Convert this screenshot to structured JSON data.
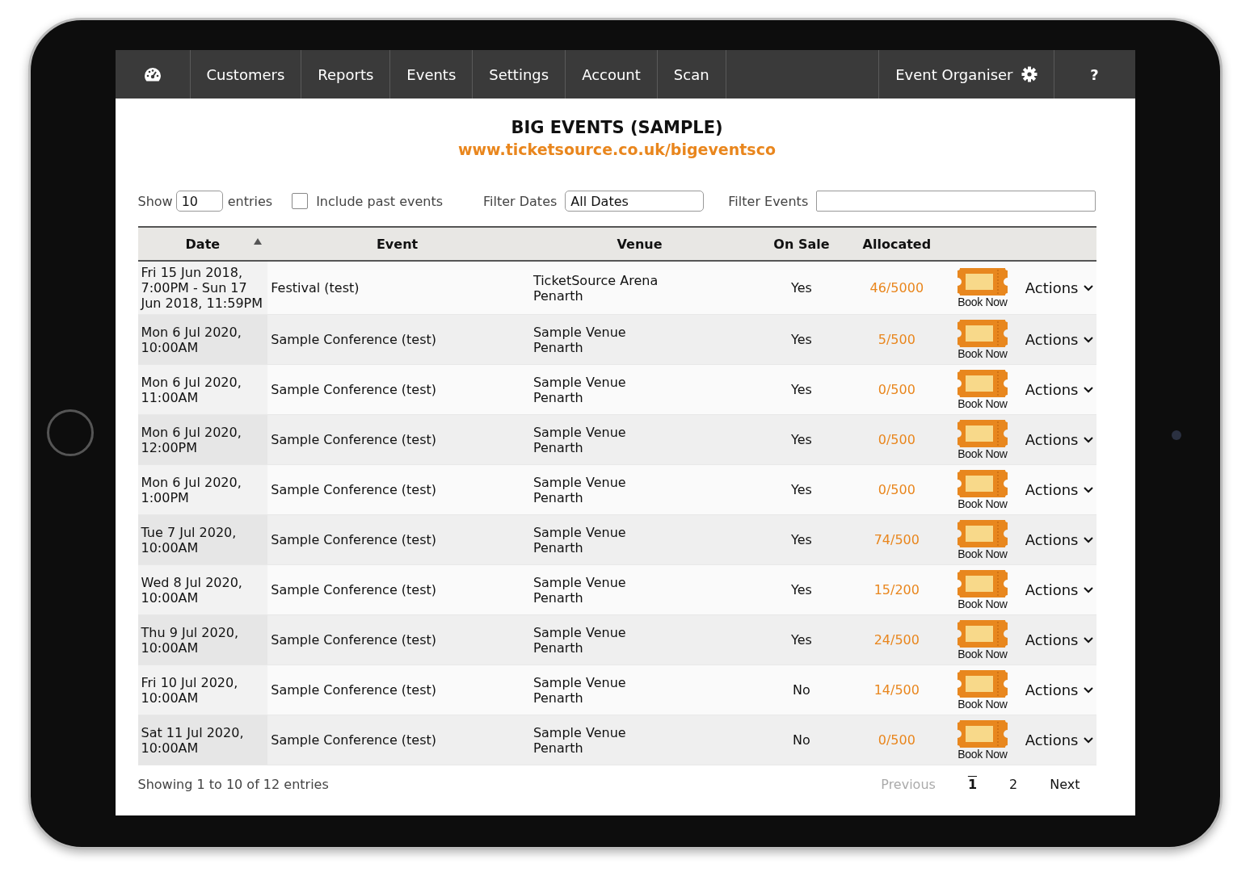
{
  "nav": {
    "items": [
      {
        "label": "Customers"
      },
      {
        "label": "Reports"
      },
      {
        "label": "Events"
      },
      {
        "label": "Settings"
      },
      {
        "label": "Account"
      },
      {
        "label": "Scan"
      }
    ],
    "user": "Event Organiser",
    "help": "?"
  },
  "header": {
    "title": "BIG EVENTS (SAMPLE)",
    "url": "www.ticketsource.co.uk/bigeventsco"
  },
  "filters": {
    "show_label": "Show",
    "show_value": "10",
    "entries_label": "entries",
    "include_past": {
      "label": "Include past events",
      "checked": false
    },
    "dates_label": "Filter Dates",
    "dates_value": "All Dates",
    "events_label": "Filter Events"
  },
  "table": {
    "columns": [
      {
        "label": "Date",
        "sorted": true
      },
      {
        "label": "Event",
        "sorted": false
      },
      {
        "label": "Venue",
        "sorted": false
      },
      {
        "label": "On Sale",
        "sorted": false
      },
      {
        "label": "Allocated",
        "sorted": false
      }
    ],
    "rows": [
      {
        "date": "Fri 15 Jun 2018, 7:00PM - Sun 17 Jun 2018, 11:59PM",
        "event": "Festival (test)",
        "venue": [
          "TicketSource Arena",
          "Penarth"
        ],
        "on_sale": "Yes",
        "allocated": "46/5000",
        "book": "Book Now",
        "actions": "Actions"
      },
      {
        "date": "Mon 6 Jul 2020, 10:00AM",
        "event": "Sample Conference (test)",
        "venue": [
          "Sample Venue",
          "Penarth"
        ],
        "on_sale": "Yes",
        "allocated": "5/500",
        "book": "Book Now",
        "actions": "Actions"
      },
      {
        "date": "Mon 6 Jul 2020, 11:00AM",
        "event": "Sample Conference (test)",
        "venue": [
          "Sample Venue",
          "Penarth"
        ],
        "on_sale": "Yes",
        "allocated": "0/500",
        "book": "Book Now",
        "actions": "Actions"
      },
      {
        "date": "Mon 6 Jul 2020, 12:00PM",
        "event": "Sample Conference (test)",
        "venue": [
          "Sample Venue",
          "Penarth"
        ],
        "on_sale": "Yes",
        "allocated": "0/500",
        "book": "Book Now",
        "actions": "Actions"
      },
      {
        "date": "Mon 6 Jul 2020, 1:00PM",
        "event": "Sample Conference (test)",
        "venue": [
          "Sample Venue",
          "Penarth"
        ],
        "on_sale": "Yes",
        "allocated": "0/500",
        "book": "Book Now",
        "actions": "Actions"
      },
      {
        "date": "Tue 7 Jul 2020, 10:00AM",
        "event": "Sample Conference (test)",
        "venue": [
          "Sample Venue",
          "Penarth"
        ],
        "on_sale": "Yes",
        "allocated": "74/500",
        "book": "Book Now",
        "actions": "Actions"
      },
      {
        "date": "Wed 8 Jul 2020, 10:00AM",
        "event": "Sample Conference (test)",
        "venue": [
          "Sample Venue",
          "Penarth"
        ],
        "on_sale": "Yes",
        "allocated": "15/200",
        "book": "Book Now",
        "actions": "Actions"
      },
      {
        "date": "Thu 9 Jul 2020, 10:00AM",
        "event": "Sample Conference (test)",
        "venue": [
          "Sample Venue",
          "Penarth"
        ],
        "on_sale": "Yes",
        "allocated": "24/500",
        "book": "Book Now",
        "actions": "Actions"
      },
      {
        "date": "Fri 10 Jul 2020, 10:00AM",
        "event": "Sample Conference (test)",
        "venue": [
          "Sample Venue",
          "Penarth"
        ],
        "on_sale": "No",
        "allocated": "14/500",
        "book": "Book Now",
        "actions": "Actions"
      },
      {
        "date": "Sat 11 Jul 2020, 10:00AM",
        "event": "Sample Conference (test)",
        "venue": [
          "Sample Venue",
          "Penarth"
        ],
        "on_sale": "No",
        "allocated": "0/500",
        "book": "Book Now",
        "actions": "Actions"
      }
    ]
  },
  "footer": {
    "info": "Showing 1 to 10 of 12 entries",
    "previous": {
      "label": "Previous",
      "disabled": true
    },
    "pages": [
      {
        "label": "1",
        "selected": true
      },
      {
        "label": "2",
        "selected": false
      }
    ],
    "next": {
      "label": "Next",
      "disabled": false
    }
  }
}
